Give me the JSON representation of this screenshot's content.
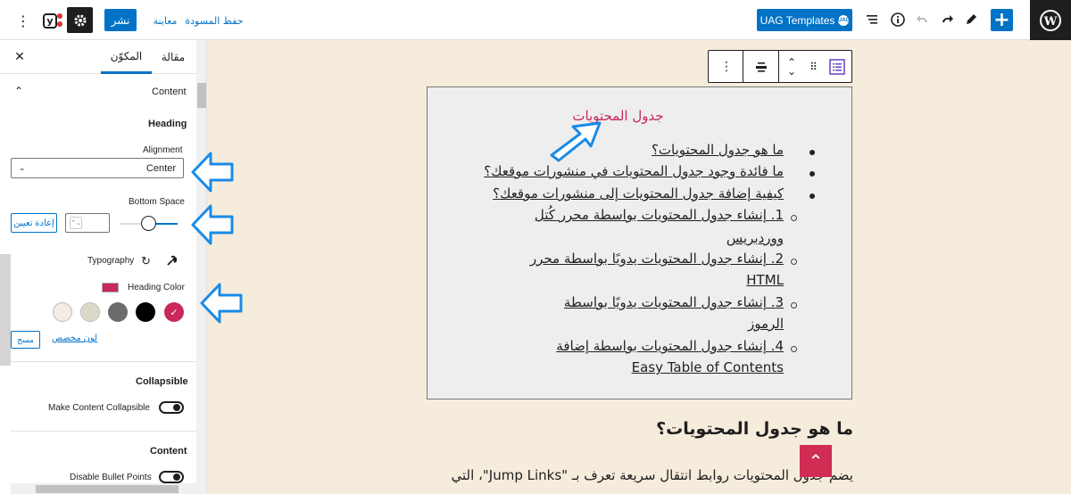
{
  "topbar": {
    "uag_templates_label": "UAG Templates",
    "uag_badge": "UAG",
    "publish_label": "نشر",
    "preview_label": "معاينة",
    "save_draft_label": "حفظ المسودة",
    "yoast_label": "y"
  },
  "sidebar": {
    "tabs": {
      "post": "مقالة",
      "block": "المكوّن"
    },
    "section_content": "Content",
    "heading_label": "Heading",
    "alignment_label": "Alignment",
    "alignment_value": "Center",
    "bottom_space_label": "Bottom Space",
    "reset_label": "إعادة تعيين",
    "typography_label": "Typography",
    "heading_color_label": "Heading Color",
    "custom_color_label": "لون مخصص",
    "clear_label": "مسح",
    "collapsible_label": "Collapsible",
    "make_collapsible_label": "Make Content Collapsible",
    "content_label": "Content",
    "disable_bullets_label": "Disable Bullet Points",
    "swatches": [
      "#f1ede2",
      "#ddd9c9",
      "#6b6b6b",
      "#000000",
      "#c8285a"
    ],
    "heading_color": "#c8285a"
  },
  "toc": {
    "title": "جدول المحتويات",
    "items": [
      {
        "text": "ما هو جدول المحتويات؟",
        "level": 1
      },
      {
        "text": "ما فائدة وجود جدول المحتويات في منشورات موقعك؟",
        "level": 1
      },
      {
        "text": "كيفية إضافة جدول المحتويات إلى منشورات موقعك؟",
        "level": 1
      },
      {
        "text": "1. إنشاء جدول المحتويات بواسطة محرر كُتل",
        "cont": "ووردبريس",
        "level": 2
      },
      {
        "text": "2. إنشاء جدول المحتويات يدويًا بواسطة محرر",
        "cont": "HTML",
        "level": 2
      },
      {
        "text": "3. إنشاء جدول المحتويات يدويًا بواسطة",
        "cont": "الرموز",
        "level": 2
      },
      {
        "text": "4. إنشاء جدول المحتويات بواسطة إضافة",
        "cont": "Easy Table of Contents",
        "level": 2
      }
    ]
  },
  "post": {
    "heading": "ما هو جدول المحتويات؟",
    "paragraph": "يضم جدول المحتويات روابط انتقال سريعة تعرف بـ \"Jump Links\"، التي"
  },
  "colors": {
    "accent": "#0073c7",
    "toc_title": "#c8285a",
    "arrow": "#1a8be6"
  }
}
